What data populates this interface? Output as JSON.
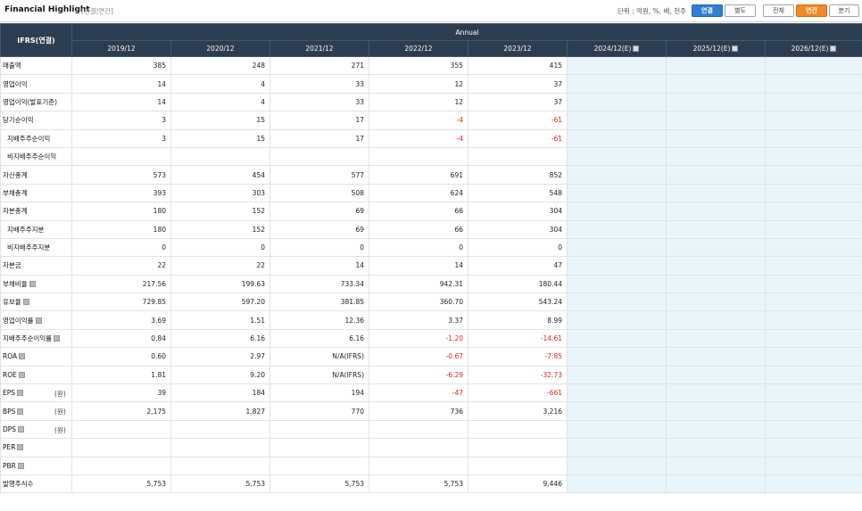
{
  "header": {
    "title": "Financial Highlight",
    "subtitle": "[연결|연간]",
    "unit_label": "단위 : 억원, %, 배, 천주",
    "buttons": [
      {
        "label": "연결",
        "active": true
      },
      {
        "label": "별도",
        "active": false
      },
      {
        "label": "전체",
        "active": false
      },
      {
        "label": "연간",
        "active": true
      },
      {
        "label": "분기",
        "active": false
      }
    ]
  },
  "table": {
    "corner_label": "IFRS(연결)",
    "group_label": "Annual",
    "columns": [
      "2019/12",
      "2020/12",
      "2021/12",
      "2022/12",
      "2023/12",
      "2024/12(E)",
      "2025/12(E)",
      "2026/12(E)"
    ],
    "rows": [
      {
        "label": "매출액",
        "values": [
          "385",
          "248",
          "271",
          "355",
          "415",
          "",
          "",
          ""
        ]
      },
      {
        "label": "영업이익",
        "values": [
          "14",
          "4",
          "33",
          "12",
          "37",
          "",
          "",
          ""
        ]
      },
      {
        "label": "영업이익(발표기준)",
        "values": [
          "14",
          "4",
          "33",
          "12",
          "37",
          "",
          "",
          ""
        ]
      },
      {
        "label": "당기순이익",
        "values": [
          "3",
          "15",
          "17",
          "-4",
          "-61",
          "",
          "",
          ""
        ]
      },
      {
        "label": "지배주주순이익",
        "values": [
          "3",
          "15",
          "17",
          "-4",
          "-61",
          "",
          "",
          ""
        ]
      },
      {
        "label": "비지배주주순이익",
        "values": [
          "",
          "",
          "",
          "",
          "",
          "",
          "",
          ""
        ]
      },
      {
        "label": "자산총계",
        "values": [
          "573",
          "454",
          "577",
          "691",
          "852",
          "",
          "",
          ""
        ]
      },
      {
        "label": "부채총계",
        "values": [
          "393",
          "303",
          "508",
          "624",
          "548",
          "",
          "",
          ""
        ]
      },
      {
        "label": "자본총계",
        "values": [
          "180",
          "152",
          "69",
          "66",
          "304",
          "",
          "",
          ""
        ]
      },
      {
        "label": "지배주주지분",
        "values": [
          "180",
          "152",
          "69",
          "66",
          "304",
          "",
          "",
          ""
        ]
      },
      {
        "label": "비지배주주지분",
        "values": [
          "0",
          "0",
          "0",
          "0",
          "0",
          "",
          "",
          ""
        ]
      },
      {
        "label": "자본금",
        "values": [
          "22",
          "22",
          "14",
          "14",
          "47",
          "",
          "",
          ""
        ]
      },
      {
        "label": "부채비율",
        "values": [
          "217.56",
          "199.63",
          "733.34",
          "942.31",
          "180.44",
          "",
          "",
          ""
        ]
      },
      {
        "label": "유보율",
        "values": [
          "729.85",
          "597.20",
          "381.85",
          "360.70",
          "543.24",
          "",
          "",
          ""
        ]
      },
      {
        "label": "영업이익률",
        "values": [
          "3.69",
          "1.51",
          "12.36",
          "3.37",
          "8.99",
          "",
          "",
          ""
        ]
      },
      {
        "label": "지배주주순이익률",
        "values": [
          "0.84",
          "6.16",
          "6.16",
          "-1.20",
          "-14.61",
          "",
          "",
          ""
        ]
      },
      {
        "label": "ROA",
        "values": [
          "0.60",
          "2.97",
          "N/A(IFRS)",
          "-0.67",
          "-7.85",
          "",
          "",
          ""
        ]
      },
      {
        "label": "ROE",
        "values": [
          "1.81",
          "9.20",
          "N/A(IFRS)",
          "-6.29",
          "-32.73",
          "",
          "",
          ""
        ]
      },
      {
        "label": "EPS",
        "unit": "(원)",
        "values": [
          "39",
          "184",
          "194",
          "-47",
          "-661",
          "",
          "",
          ""
        ]
      },
      {
        "label": "BPS",
        "unit": "(원)",
        "values": [
          "2,175",
          "1,827",
          "770",
          "736",
          "3,216",
          "",
          "",
          ""
        ]
      },
      {
        "label": "DPS",
        "unit": "(원)",
        "values": [
          "",
          "",
          "",
          "",
          "",
          "",
          "",
          ""
        ]
      },
      {
        "label": "PER",
        "values": [
          "",
          "",
          "",
          "",
          "",
          "",
          "",
          ""
        ]
      },
      {
        "label": "PBR",
        "values": [
          "",
          "",
          "",
          "",
          "",
          "",
          "",
          ""
        ]
      },
      {
        "label": "발행주식수",
        "values": [
          "5,753",
          "5,753",
          "5,753",
          "5,753",
          "9,446",
          "",
          "",
          ""
        ]
      }
    ]
  },
  "colors": {
    "header_bg": "#2c3d4f",
    "estimate_bg": "#e8f4fa",
    "negative": "#e0251b",
    "button_active_blue": "#2f7fd4",
    "button_active_orange": "#f08a24"
  }
}
